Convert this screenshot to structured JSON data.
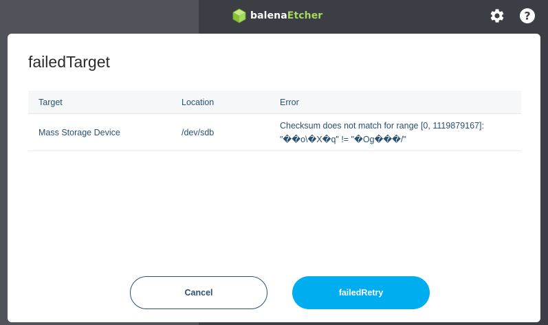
{
  "app": {
    "brand_prefix": "balena",
    "brand_suffix": "Etcher",
    "icons": [
      "cube-logo-icon",
      "gear-icon",
      "help-icon"
    ],
    "colors": {
      "logo_accent": "#a6d95f",
      "primary": "#00aeef",
      "text": "#2a506f"
    }
  },
  "modal": {
    "title": "failedTarget",
    "table": {
      "headers": [
        "Target",
        "Location",
        "Error"
      ],
      "rows": [
        {
          "target": "Mass Storage Device",
          "location": "/dev/sdb",
          "error_line1": "Checksum does not match for range [0, 1119879167]:",
          "error_line2": "\"��o\\�X�q\" != \"�Og���/\""
        }
      ]
    },
    "buttons": {
      "cancel": "Cancel",
      "retry": "failedRetry"
    }
  }
}
